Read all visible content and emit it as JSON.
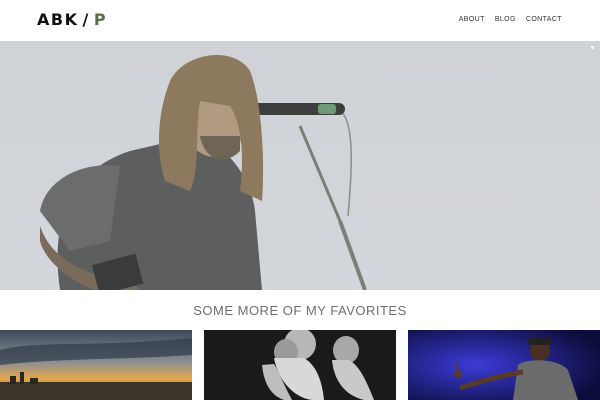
{
  "header": {
    "logo_left": "ABK",
    "logo_sep": "/",
    "logo_right": "P",
    "nav": [
      {
        "label": "ABOUT"
      },
      {
        "label": "BLOG"
      },
      {
        "label": "CONTACT"
      }
    ]
  },
  "hero": {
    "image": "singer-microphone-photo"
  },
  "favorites": {
    "title": "SOME MORE OF MY FAVORITES",
    "thumbnails": [
      {
        "image": "city-sunset-skyline-photo"
      },
      {
        "image": "bearded-man-triple-portrait-photo"
      },
      {
        "image": "performer-stage-blue-light-photo"
      }
    ]
  },
  "colors": {
    "accent": "#5d6b4a",
    "hero_bg": "#d1d4d8",
    "title_text": "#6f6f6f"
  }
}
